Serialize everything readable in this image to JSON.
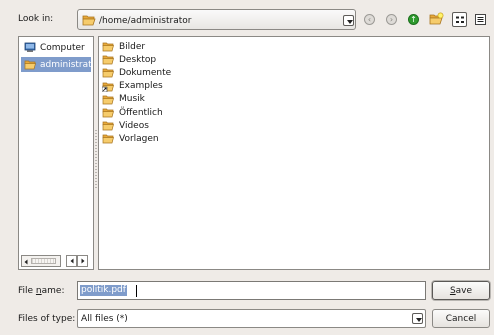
{
  "look_in": {
    "label_pre": "Look in:",
    "path": "/home/administrator"
  },
  "toolbar": {
    "back_icon": "back-arrow-icon",
    "forward_icon": "forward-arrow-icon",
    "up_icon": "up-arrow-icon",
    "new_folder_icon": "new-folder-icon",
    "list_view_icon": "list-view-icon",
    "detail_view_icon": "detail-view-icon"
  },
  "sidebar": {
    "items": [
      {
        "label": "Computer",
        "icon": "computer-icon",
        "selected": false
      },
      {
        "label": "administrator",
        "icon": "folder-icon",
        "selected": true
      }
    ]
  },
  "files": [
    {
      "name": "Bilder",
      "icon": "folder-icon"
    },
    {
      "name": "Desktop",
      "icon": "folder-icon"
    },
    {
      "name": "Dokumente",
      "icon": "folder-icon"
    },
    {
      "name": "Examples",
      "icon": "folder-link-icon"
    },
    {
      "name": "Musik",
      "icon": "folder-icon"
    },
    {
      "name": "Öffentlich",
      "icon": "folder-icon"
    },
    {
      "name": "Videos",
      "icon": "folder-icon"
    },
    {
      "name": "Vorlagen",
      "icon": "folder-icon"
    }
  ],
  "file_name": {
    "label_pre": "File ",
    "label_accel": "n",
    "label_post": "ame:",
    "value": "politik.pdf"
  },
  "file_type": {
    "label": "Files of type:",
    "value": "All files (*)"
  },
  "buttons": {
    "save_accel": "S",
    "save_rest": "ave",
    "cancel": "Cancel"
  },
  "colors": {
    "background": "#efebe7",
    "selection": "#7f9ccb",
    "folder": "#f2b84b"
  }
}
